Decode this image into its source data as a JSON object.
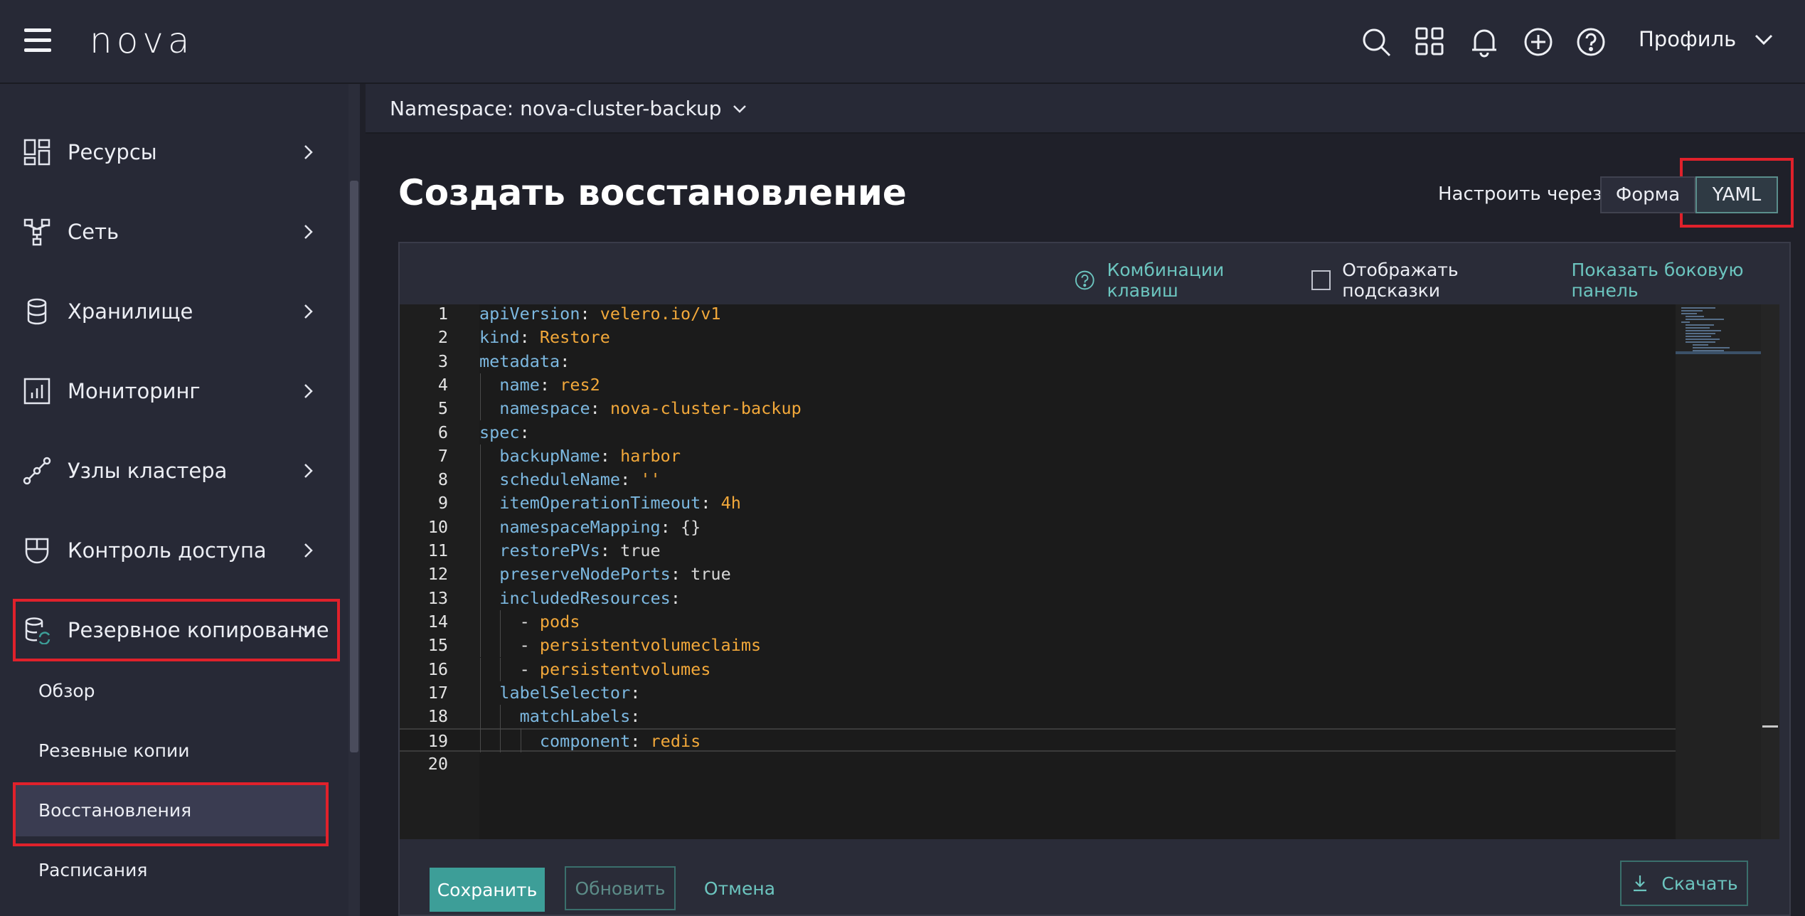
{
  "app": {
    "logo": "nova"
  },
  "header": {
    "profile_label": "Профиль"
  },
  "sidebar": {
    "items": [
      {
        "label": "Ресурсы",
        "icon": "grid-icon"
      },
      {
        "label": "Сеть",
        "icon": "network-icon"
      },
      {
        "label": "Хранилище",
        "icon": "database-icon"
      },
      {
        "label": "Мониторинг",
        "icon": "chart-icon"
      },
      {
        "label": "Узлы кластера",
        "icon": "nodes-icon"
      },
      {
        "label": "Контроль доступа",
        "icon": "shield-icon"
      },
      {
        "label": "Резервное копирование",
        "icon": "backup-icon",
        "expanded": true
      }
    ],
    "subitems": [
      {
        "label": "Обзор"
      },
      {
        "label": "Резевные копии"
      },
      {
        "label": "Восстановления",
        "active": true
      },
      {
        "label": "Расписания"
      }
    ]
  },
  "namespace": {
    "label": "Namespace: nova-cluster-backup"
  },
  "page": {
    "title": "Создать восстановление",
    "configure_via": "Настроить через:",
    "modes": [
      {
        "label": "Форма"
      },
      {
        "label": "YAML",
        "selected": true
      }
    ]
  },
  "editor": {
    "shortcuts_label": "Комбинации клавиш",
    "show_hints_label": "Отображать подсказки",
    "show_hints_checked": false,
    "sidepanel_label": "Показать боковую панель",
    "lines": [
      {
        "n": "1",
        "indent": "",
        "key": "apiVersion",
        "sep": ": ",
        "val": "velero.io/v1"
      },
      {
        "n": "2",
        "indent": "",
        "key": "kind",
        "sep": ": ",
        "val": "Restore"
      },
      {
        "n": "3",
        "indent": "",
        "key": "metadata",
        "sep": ":",
        "val": ""
      },
      {
        "n": "4",
        "indent": "  ",
        "key": "name",
        "sep": ": ",
        "val": "res2"
      },
      {
        "n": "5",
        "indent": "  ",
        "key": "namespace",
        "sep": ": ",
        "val": "nova-cluster-backup"
      },
      {
        "n": "6",
        "indent": "",
        "key": "spec",
        "sep": ":",
        "val": ""
      },
      {
        "n": "7",
        "indent": "  ",
        "key": "backupName",
        "sep": ": ",
        "val": "harbor"
      },
      {
        "n": "8",
        "indent": "  ",
        "key": "scheduleName",
        "sep": ": ",
        "val": "''"
      },
      {
        "n": "9",
        "indent": "  ",
        "key": "itemOperationTimeout",
        "sep": ": ",
        "val": "4h"
      },
      {
        "n": "10",
        "indent": "  ",
        "key": "namespaceMapping",
        "sep": ": ",
        "val": "{}"
      },
      {
        "n": "11",
        "indent": "  ",
        "key": "restorePVs",
        "sep": ": ",
        "val": "true"
      },
      {
        "n": "12",
        "indent": "  ",
        "key": "preserveNodePorts",
        "sep": ": ",
        "val": "true"
      },
      {
        "n": "13",
        "indent": "  ",
        "key": "includedResources",
        "sep": ":",
        "val": ""
      },
      {
        "n": "14",
        "indent": "    ",
        "key": "",
        "sep": "- ",
        "val": "pods"
      },
      {
        "n": "15",
        "indent": "    ",
        "key": "",
        "sep": "- ",
        "val": "persistentvolumeclaims"
      },
      {
        "n": "16",
        "indent": "    ",
        "key": "",
        "sep": "- ",
        "val": "persistentvolumes"
      },
      {
        "n": "17",
        "indent": "  ",
        "key": "labelSelector",
        "sep": ":",
        "val": ""
      },
      {
        "n": "18",
        "indent": "    ",
        "key": "matchLabels",
        "sep": ":",
        "val": ""
      },
      {
        "n": "19",
        "indent": "      ",
        "key": "component",
        "sep": ": ",
        "val": "redis"
      },
      {
        "n": "20",
        "indent": "",
        "key": "",
        "sep": "",
        "val": ""
      }
    ]
  },
  "actions": {
    "save": "Сохранить",
    "update": "Обновить",
    "cancel": "Отмена",
    "download": "Скачать"
  },
  "colors": {
    "accent": "#3d9e98",
    "link": "#6cc5bf",
    "highlight_box": "#e0212b",
    "yaml_key": "#7cb8e0",
    "yaml_value": "#f2a83a"
  }
}
